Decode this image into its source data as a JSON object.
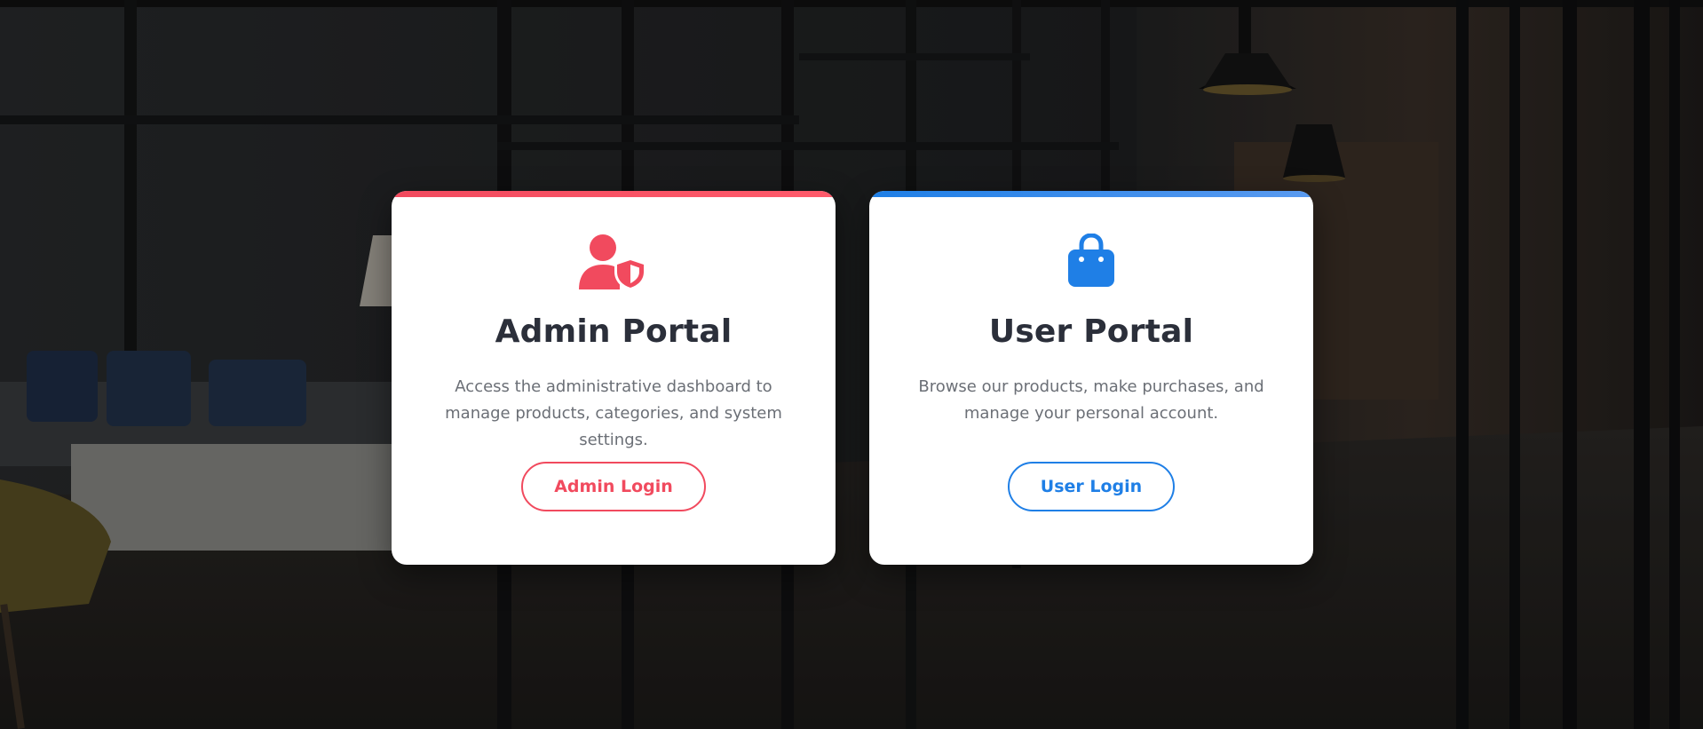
{
  "colors": {
    "admin_accent": "#f14a5e",
    "user_accent": "#1f7fe6",
    "title_text": "#2b2f3a",
    "body_text": "#6b6f76"
  },
  "admin_card": {
    "icon": "user-shield-icon",
    "title": "Admin Portal",
    "description": "Access the administrative dashboard to manage products, categories, and system settings.",
    "button_label": "Admin Login"
  },
  "user_card": {
    "icon": "shopping-bag-icon",
    "title": "User Portal",
    "description": "Browse our products, make purchases, and manage your personal account.",
    "button_label": "User Login"
  }
}
